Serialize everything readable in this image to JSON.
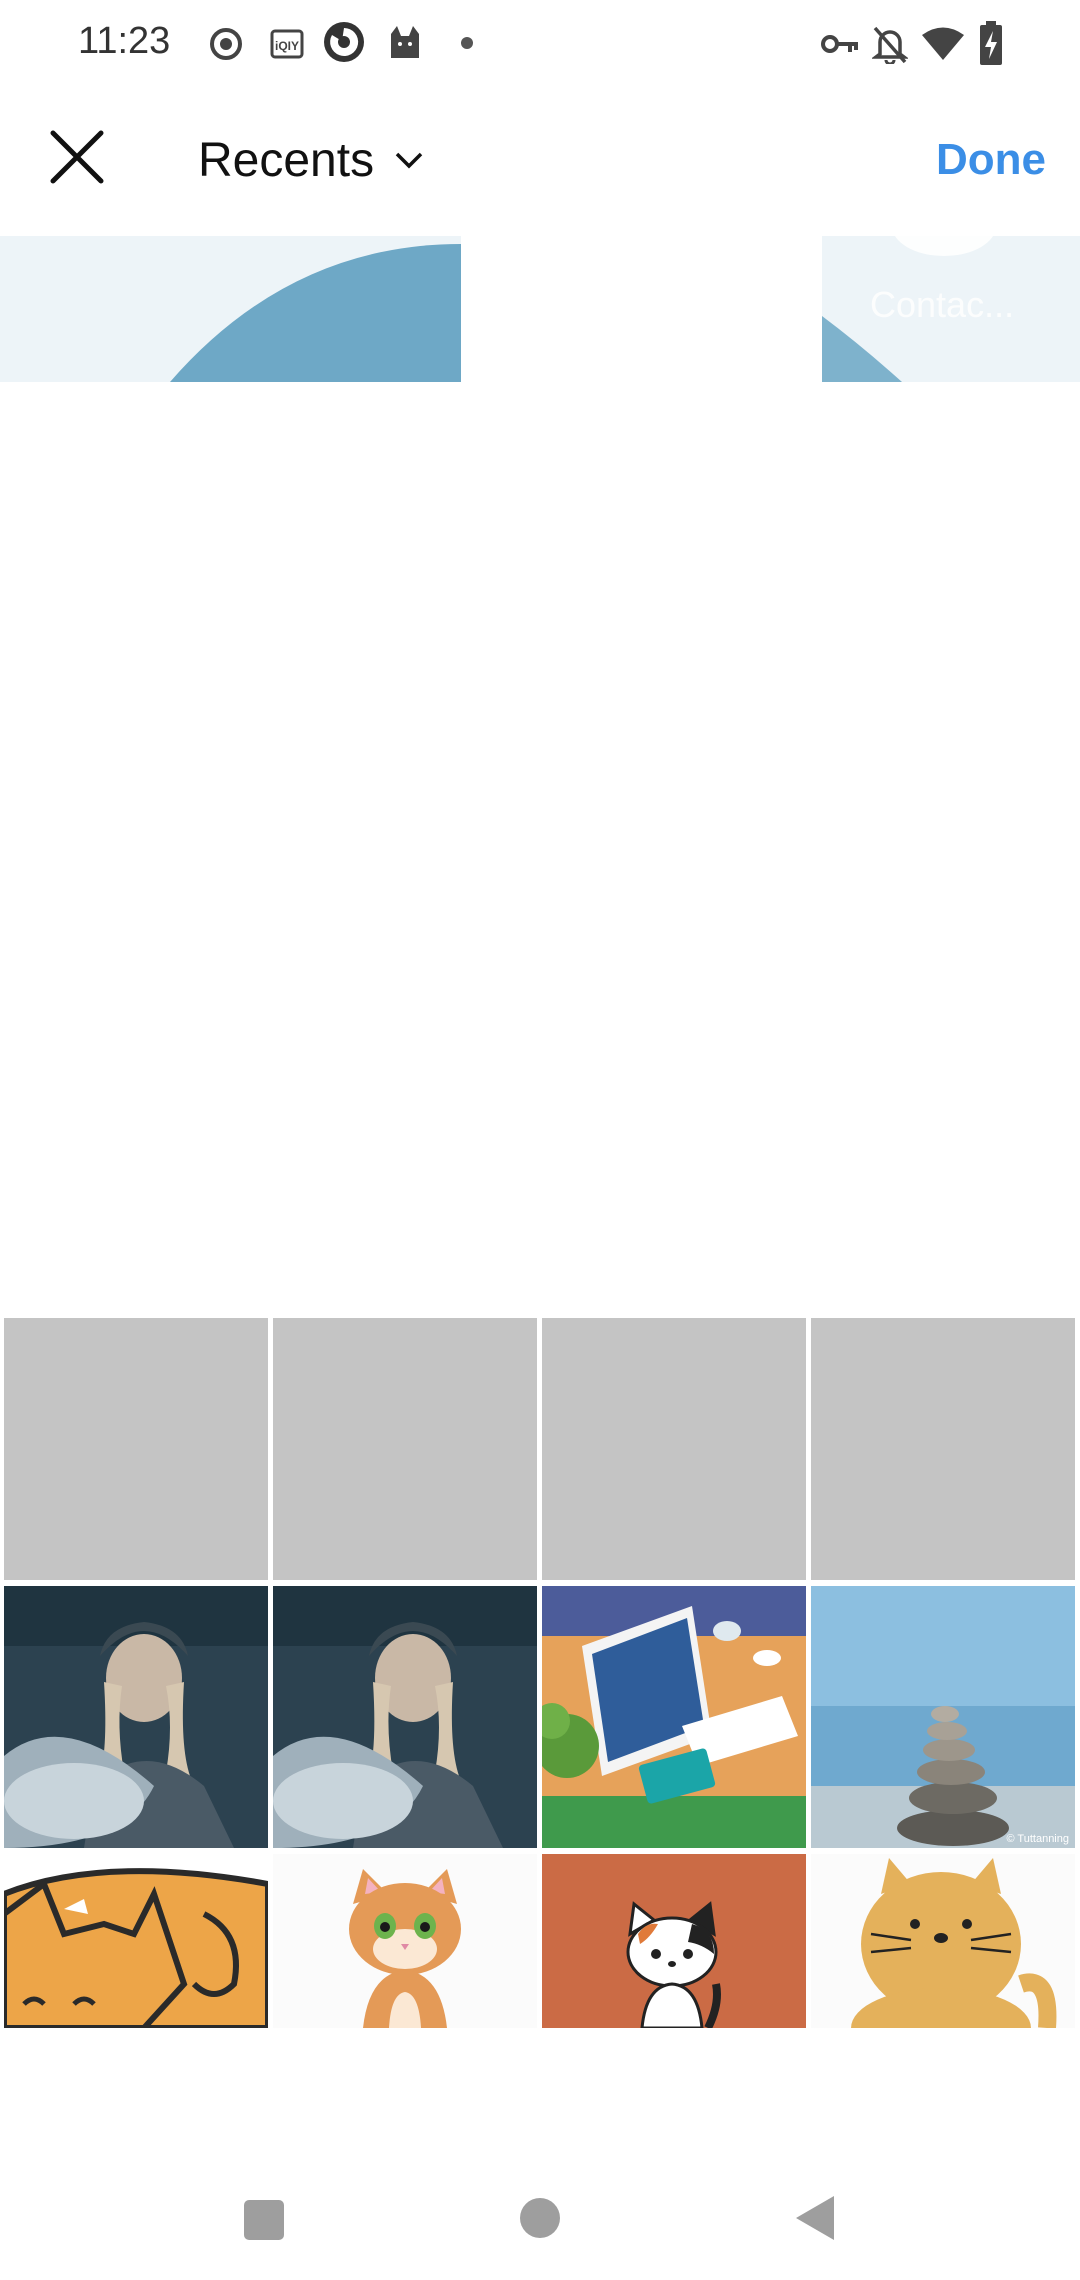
{
  "status_bar": {
    "time": "11:23",
    "left_icons": [
      "record-icon",
      "iqiyi-icon",
      "app-icon",
      "cat-icon",
      "dot-icon"
    ],
    "right_icons": [
      "vpn-key-icon",
      "bell-off-icon",
      "wifi-icon",
      "battery-charging-icon"
    ],
    "iqiyi_label": "iQIY"
  },
  "header": {
    "album_title": "Recents",
    "done_label": "Done",
    "accent_color": "#3b8ee6"
  },
  "preview": {
    "right_label": "Contac..."
  },
  "grid": {
    "placeholder_count": 4,
    "photos": [
      "woman-in-car-photo",
      "woman-in-car-photo",
      "tablet-desk-photo",
      "stacked-stones-photo",
      "orange-cat-cartoon",
      "tabby-kitten-cartoon",
      "calico-cat-cartoon",
      "yellow-cat-cartoon"
    ],
    "watermark": "© Tuttanning"
  },
  "nav_bar": {
    "icons": [
      "recents-square-icon",
      "home-circle-icon",
      "back-triangle-icon"
    ]
  }
}
